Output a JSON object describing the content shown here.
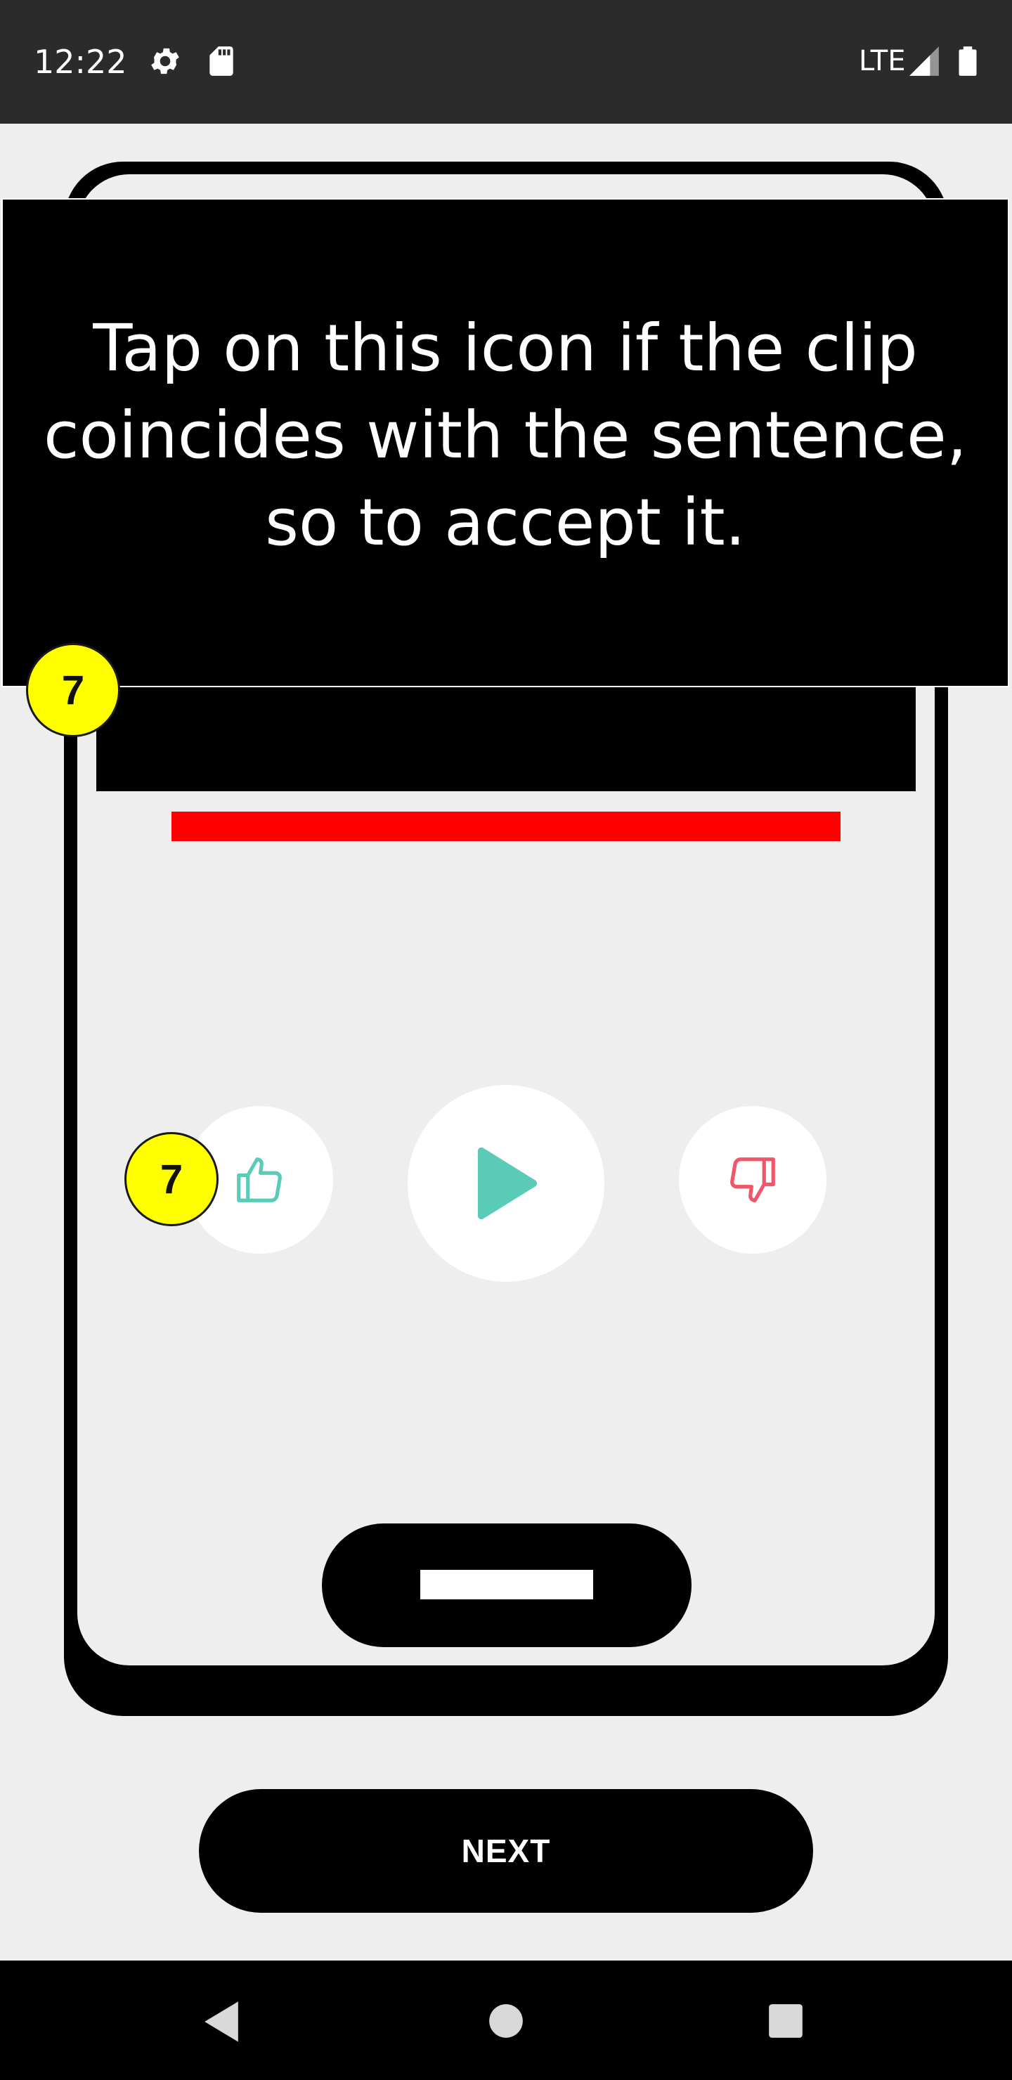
{
  "status_bar": {
    "time": "12:22",
    "network": "LTE",
    "icons": [
      "settings-icon",
      "sd-card-icon",
      "signal-icon",
      "battery-icon"
    ]
  },
  "tutorial": {
    "tooltip_text": "Tap on this icon if the clip coincides with the sentence, so to accept it.",
    "step_badge_header": "7",
    "step_badge_button": "7"
  },
  "controls": {
    "accept_icon": "thumbs-up-icon",
    "play_icon": "play-icon",
    "reject_icon": "thumbs-down-icon"
  },
  "actions": {
    "next_label": "NEXT"
  },
  "colors": {
    "accent_teal": "#59cbb7",
    "reject_red": "#f0566a",
    "highlight_red": "#ff0000",
    "badge_yellow": "#ffff00"
  },
  "navigation": {
    "buttons": [
      "back-icon",
      "home-icon",
      "recents-icon"
    ]
  }
}
